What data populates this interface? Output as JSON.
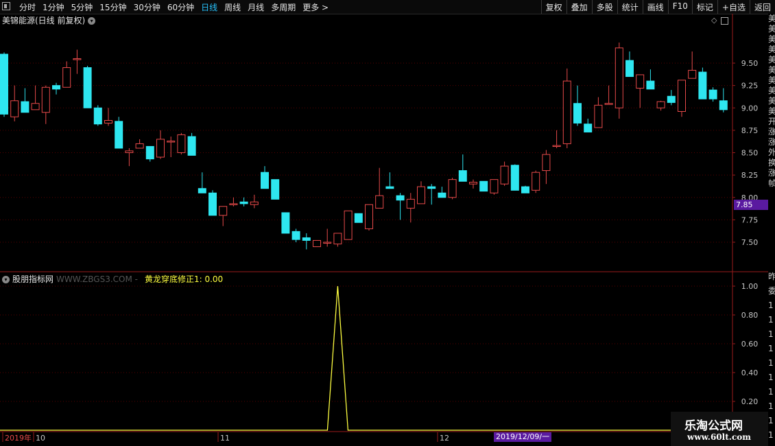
{
  "toolbar": {
    "periods": [
      "分时",
      "1分钟",
      "5分钟",
      "15分钟",
      "30分钟",
      "60分钟",
      "日线",
      "周线",
      "月线",
      "多周期",
      "更多 >"
    ],
    "active_period": "日线",
    "tools": [
      "复权",
      "叠加",
      "多股",
      "统计",
      "画线",
      "F10",
      "标记",
      "+自选",
      "返回"
    ]
  },
  "main_chart": {
    "title": "美锦能源(日线 前复权)",
    "price_ticks": [
      "9.50",
      "9.25",
      "9.00",
      "8.75",
      "8.50",
      "8.25",
      "8.00",
      "7.75",
      "7.50"
    ],
    "current_price": "7.85"
  },
  "indicator": {
    "panel_name": "股朋指标网",
    "watermark": "WWW.ZBGS3.COM -",
    "label": "黄龙穿底修正1: 0.00",
    "ticks": [
      "1.00",
      "0.80",
      "0.60",
      "0.40",
      "0.20"
    ]
  },
  "xaxis": {
    "labels": [
      "2019年",
      "10",
      "11",
      "12"
    ],
    "cursor_date": "2019/12/09/一"
  },
  "side_chars": [
    "美",
    "美",
    "美",
    "美",
    "美",
    "美",
    "美",
    "美",
    "美",
    "美",
    "开",
    "涨",
    "涨",
    "外",
    "换",
    "涨",
    "帧"
  ],
  "side_chars_lower": [
    "昨",
    "委",
    "1",
    "1",
    "1",
    "1",
    "1",
    "1",
    "1",
    "1",
    "1",
    "1"
  ],
  "logo": {
    "line1": "乐淘公式网",
    "line2": "www.60lt.com"
  },
  "colors": {
    "up": "#e84a4a",
    "down": "#2ee6f0",
    "indicator": "#ffff40",
    "grid": "#5a0000",
    "axis": "#9b1b1b"
  },
  "chart_data": [
    {
      "type": "candlestick",
      "title": "美锦能源(日线 前复权)",
      "ylim": [
        7.3,
        9.9
      ],
      "candles": [
        {
          "o": 9.6,
          "h": 9.62,
          "l": 8.9,
          "c": 8.93
        },
        {
          "o": 8.9,
          "h": 9.25,
          "l": 8.85,
          "c": 9.08
        },
        {
          "o": 9.07,
          "h": 9.22,
          "l": 8.95,
          "c": 8.95
        },
        {
          "o": 8.98,
          "h": 9.25,
          "l": 8.98,
          "c": 9.05
        },
        {
          "o": 8.95,
          "h": 9.25,
          "l": 8.82,
          "c": 9.23
        },
        {
          "o": 9.25,
          "h": 9.28,
          "l": 9.15,
          "c": 9.21
        },
        {
          "o": 9.23,
          "h": 9.52,
          "l": 9.23,
          "c": 9.45
        },
        {
          "o": 9.55,
          "h": 9.65,
          "l": 9.38,
          "c": 9.55
        },
        {
          "o": 9.45,
          "h": 9.47,
          "l": 9.0,
          "c": 9.0
        },
        {
          "o": 9.0,
          "h": 9.03,
          "l": 8.8,
          "c": 8.82
        },
        {
          "o": 8.83,
          "h": 9.0,
          "l": 8.8,
          "c": 8.86
        },
        {
          "o": 8.85,
          "h": 8.9,
          "l": 8.55,
          "c": 8.55
        },
        {
          "o": 8.5,
          "h": 8.55,
          "l": 8.35,
          "c": 8.52
        },
        {
          "o": 8.55,
          "h": 8.65,
          "l": 8.55,
          "c": 8.6
        },
        {
          "o": 8.57,
          "h": 8.57,
          "l": 8.4,
          "c": 8.43
        },
        {
          "o": 8.45,
          "h": 8.75,
          "l": 8.43,
          "c": 8.65
        },
        {
          "o": 8.62,
          "h": 8.68,
          "l": 8.45,
          "c": 8.63
        },
        {
          "o": 8.5,
          "h": 8.72,
          "l": 8.48,
          "c": 8.7
        },
        {
          "o": 8.68,
          "h": 8.72,
          "l": 8.47,
          "c": 8.47
        },
        {
          "o": 8.1,
          "h": 8.28,
          "l": 8.05,
          "c": 8.05
        },
        {
          "o": 8.05,
          "h": 8.08,
          "l": 7.8,
          "c": 7.8
        },
        {
          "o": 7.8,
          "h": 7.9,
          "l": 7.68,
          "c": 7.9
        },
        {
          "o": 7.92,
          "h": 8.0,
          "l": 7.9,
          "c": 7.93
        },
        {
          "o": 7.95,
          "h": 8.0,
          "l": 7.9,
          "c": 7.93
        },
        {
          "o": 7.92,
          "h": 8.03,
          "l": 7.88,
          "c": 7.95
        },
        {
          "o": 8.28,
          "h": 8.35,
          "l": 8.1,
          "c": 8.1
        },
        {
          "o": 8.2,
          "h": 8.2,
          "l": 7.98,
          "c": 7.98
        },
        {
          "o": 7.83,
          "h": 7.83,
          "l": 7.6,
          "c": 7.6
        },
        {
          "o": 7.62,
          "h": 7.65,
          "l": 7.5,
          "c": 7.53
        },
        {
          "o": 7.55,
          "h": 7.6,
          "l": 7.42,
          "c": 7.52
        },
        {
          "o": 7.45,
          "h": 7.52,
          "l": 7.45,
          "c": 7.52
        },
        {
          "o": 7.5,
          "h": 7.65,
          "l": 7.45,
          "c": 7.5
        },
        {
          "o": 7.48,
          "h": 7.6,
          "l": 7.45,
          "c": 7.6
        },
        {
          "o": 7.53,
          "h": 7.85,
          "l": 7.53,
          "c": 7.85
        },
        {
          "o": 7.82,
          "h": 7.82,
          "l": 7.72,
          "c": 7.72
        },
        {
          "o": 7.65,
          "h": 7.92,
          "l": 7.63,
          "c": 7.92
        },
        {
          "o": 7.88,
          "h": 8.33,
          "l": 7.88,
          "c": 8.02
        },
        {
          "o": 8.12,
          "h": 8.28,
          "l": 8.12,
          "c": 8.1
        },
        {
          "o": 8.02,
          "h": 8.05,
          "l": 7.75,
          "c": 7.97
        },
        {
          "o": 7.88,
          "h": 8.05,
          "l": 7.72,
          "c": 7.98
        },
        {
          "o": 7.93,
          "h": 8.18,
          "l": 7.93,
          "c": 8.12
        },
        {
          "o": 8.12,
          "h": 8.15,
          "l": 7.92,
          "c": 8.1
        },
        {
          "o": 8.05,
          "h": 8.12,
          "l": 8.0,
          "c": 8.0
        },
        {
          "o": 8.0,
          "h": 8.22,
          "l": 7.98,
          "c": 8.2
        },
        {
          "o": 8.3,
          "h": 8.48,
          "l": 8.18,
          "c": 8.18
        },
        {
          "o": 8.15,
          "h": 8.2,
          "l": 8.1,
          "c": 8.17
        },
        {
          "o": 8.18,
          "h": 8.18,
          "l": 8.07,
          "c": 8.07
        },
        {
          "o": 8.05,
          "h": 8.2,
          "l": 8.03,
          "c": 8.2
        },
        {
          "o": 8.15,
          "h": 8.4,
          "l": 8.13,
          "c": 8.35
        },
        {
          "o": 8.36,
          "h": 8.37,
          "l": 8.08,
          "c": 8.08
        },
        {
          "o": 8.12,
          "h": 8.13,
          "l": 8.05,
          "c": 8.05
        },
        {
          "o": 8.08,
          "h": 8.3,
          "l": 8.05,
          "c": 8.28
        },
        {
          "o": 8.3,
          "h": 8.53,
          "l": 8.15,
          "c": 8.48
        },
        {
          "o": 8.58,
          "h": 8.75,
          "l": 8.55,
          "c": 8.58
        },
        {
          "o": 8.6,
          "h": 9.44,
          "l": 8.55,
          "c": 9.3
        },
        {
          "o": 9.05,
          "h": 9.25,
          "l": 8.8,
          "c": 8.83
        },
        {
          "o": 8.82,
          "h": 8.88,
          "l": 8.73,
          "c": 8.73
        },
        {
          "o": 8.78,
          "h": 9.12,
          "l": 8.78,
          "c": 9.03
        },
        {
          "o": 9.05,
          "h": 9.25,
          "l": 9.05,
          "c": 9.05
        },
        {
          "o": 9.0,
          "h": 9.73,
          "l": 8.88,
          "c": 9.67
        },
        {
          "o": 9.53,
          "h": 9.63,
          "l": 9.35,
          "c": 9.35
        },
        {
          "o": 9.22,
          "h": 9.37,
          "l": 9.0,
          "c": 9.37
        },
        {
          "o": 9.3,
          "h": 9.43,
          "l": 9.21,
          "c": 9.21
        },
        {
          "o": 9.0,
          "h": 9.08,
          "l": 8.97,
          "c": 9.07
        },
        {
          "o": 9.13,
          "h": 9.2,
          "l": 9.03,
          "c": 9.06
        },
        {
          "o": 8.96,
          "h": 9.31,
          "l": 8.9,
          "c": 9.31
        },
        {
          "o": 9.33,
          "h": 9.63,
          "l": 9.33,
          "c": 9.42
        },
        {
          "o": 9.4,
          "h": 9.45,
          "l": 9.1,
          "c": 9.1
        },
        {
          "o": 9.2,
          "h": 9.23,
          "l": 9.07,
          "c": 9.1
        },
        {
          "o": 9.08,
          "h": 9.22,
          "l": 8.95,
          "c": 8.98
        }
      ]
    },
    {
      "type": "line",
      "title": "黄龙穿底修正1",
      "ylim": [
        0,
        1.0
      ],
      "series": [
        {
          "name": "黄龙穿底修正1",
          "spikes": [
            {
              "index": 32,
              "value": 1.0
            }
          ],
          "baseline": 0.0
        }
      ]
    }
  ]
}
